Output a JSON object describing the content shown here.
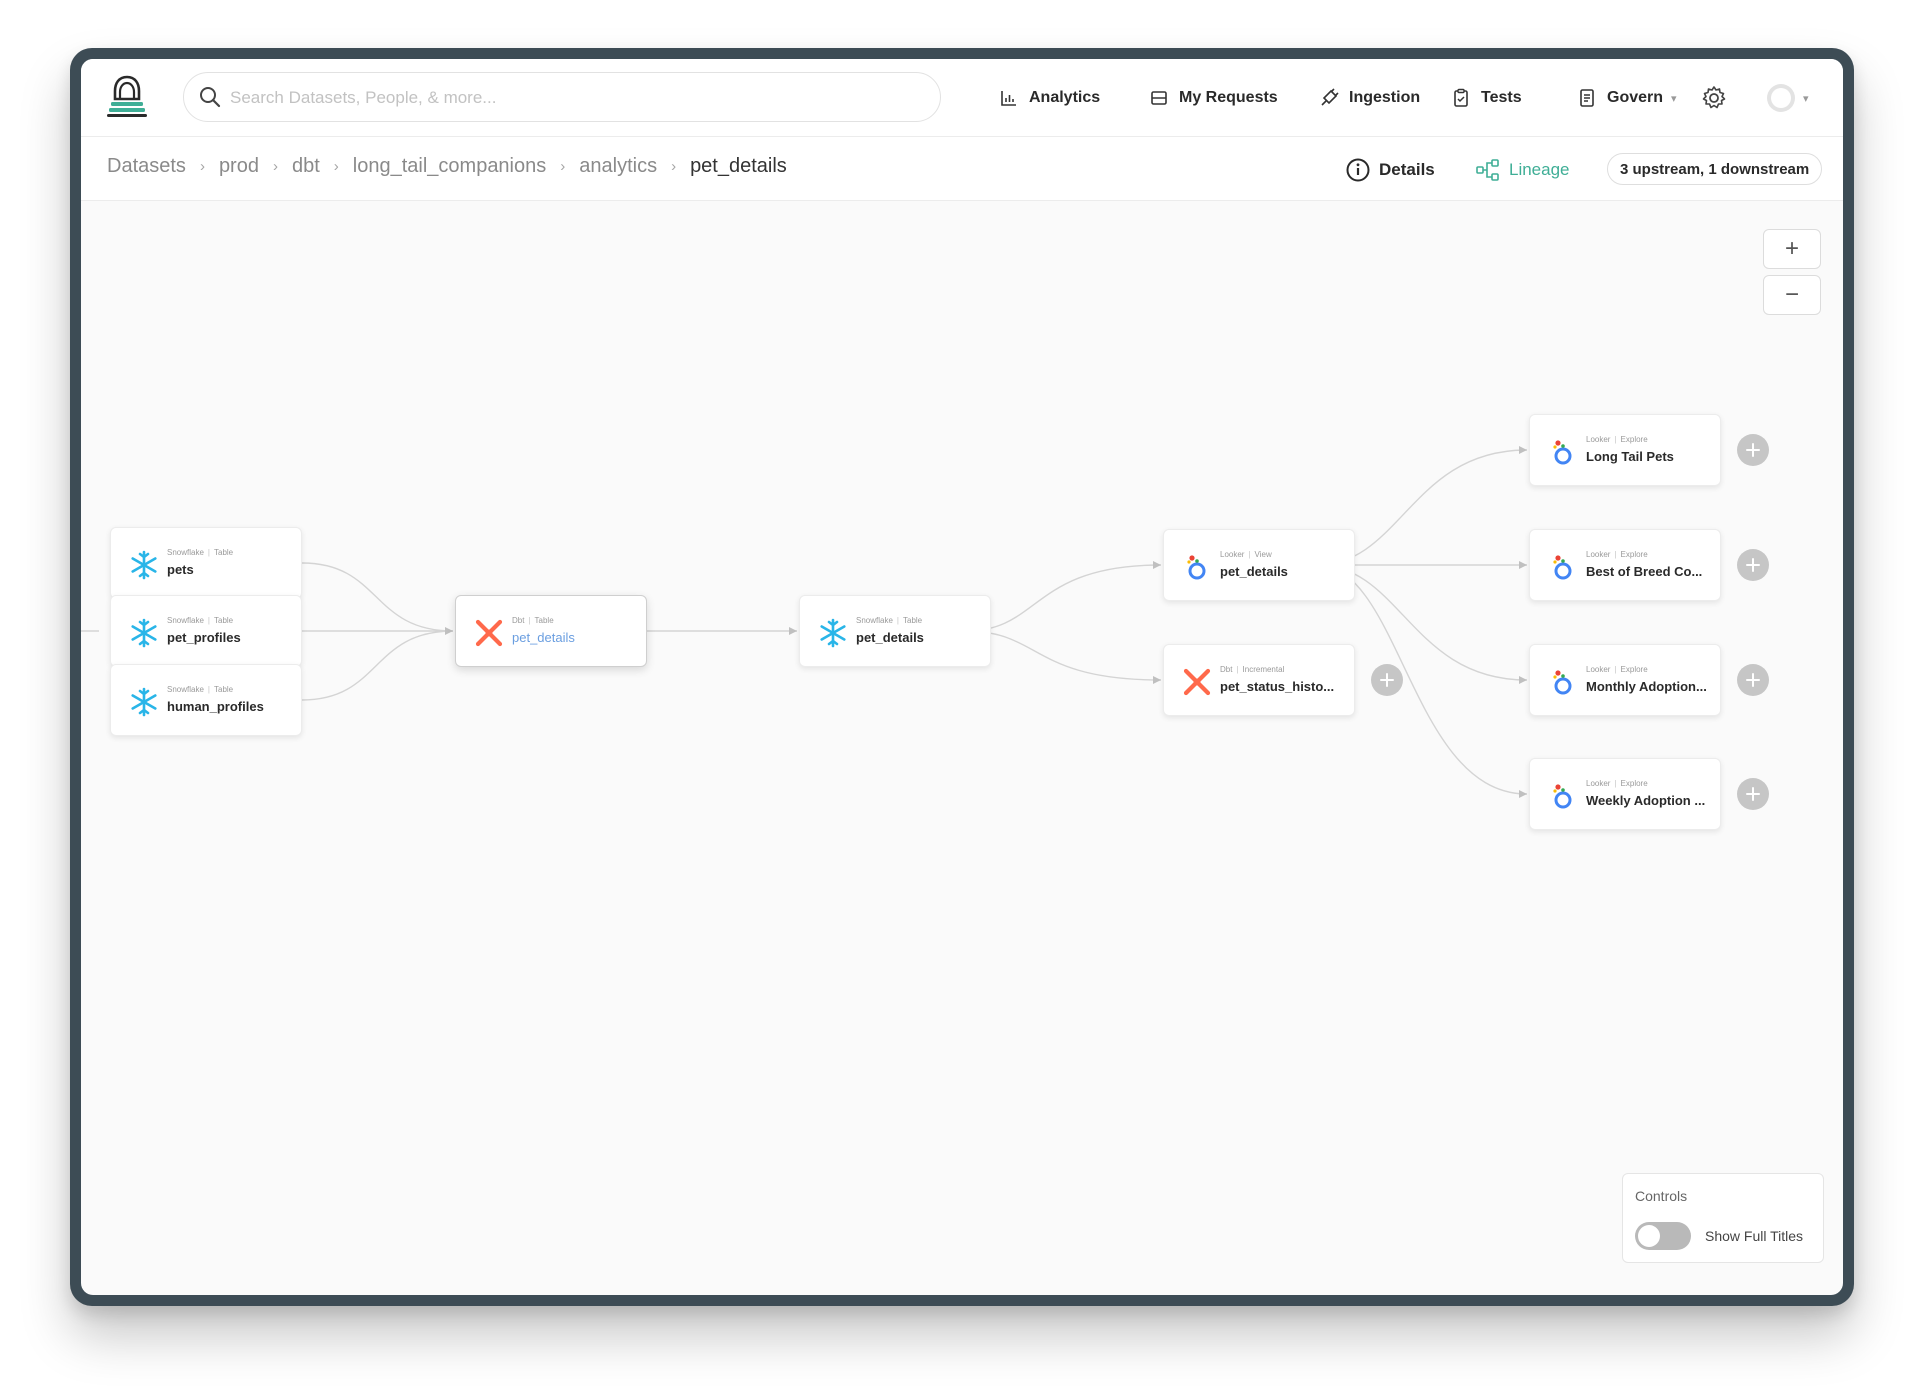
{
  "nav": {
    "search_placeholder": "Search Datasets, People, & more...",
    "items": [
      {
        "label": "Analytics",
        "icon": "bar-chart-icon"
      },
      {
        "label": "My Requests",
        "icon": "inbox-icon"
      },
      {
        "label": "Ingestion",
        "icon": "plug-icon"
      },
      {
        "label": "Tests",
        "icon": "clipboard-icon"
      },
      {
        "label": "Govern",
        "icon": "document-icon"
      }
    ]
  },
  "breadcrumb": [
    "Datasets",
    "prod",
    "dbt",
    "long_tail_companions",
    "analytics",
    "pet_details"
  ],
  "tabs": {
    "details": "Details",
    "lineage": "Lineage"
  },
  "stream_summary": "3 upstream, 1 downstream",
  "zoom": {
    "in": "+",
    "out": "−"
  },
  "nodes": {
    "pets": {
      "platform": "Snowflake",
      "type": "Table",
      "name": "pets"
    },
    "pet_profiles": {
      "platform": "Snowflake",
      "type": "Table",
      "name": "pet_profiles"
    },
    "human_profiles": {
      "platform": "Snowflake",
      "type": "Table",
      "name": "human_profiles"
    },
    "dbt_pet_details": {
      "platform": "Dbt",
      "type": "Table",
      "name": "pet_details"
    },
    "sf_pet_details": {
      "platform": "Snowflake",
      "type": "Table",
      "name": "pet_details"
    },
    "looker_pet_details": {
      "platform": "Looker",
      "type": "View",
      "name": "pet_details"
    },
    "pet_status_history": {
      "platform": "Dbt",
      "type": "Incremental",
      "name": "pet_status_histo..."
    },
    "long_tail_pets": {
      "platform": "Looker",
      "type": "Explore",
      "name": "Long Tail Pets"
    },
    "best_of_breed": {
      "platform": "Looker",
      "type": "Explore",
      "name": "Best of Breed Co..."
    },
    "monthly_adoption": {
      "platform": "Looker",
      "type": "Explore",
      "name": "Monthly Adoption..."
    },
    "weekly_adoption": {
      "platform": "Looker",
      "type": "Explore",
      "name": "Weekly Adoption ..."
    }
  },
  "controls": {
    "title": "Controls",
    "toggle_label": "Show Full Titles",
    "show_full_titles": false
  },
  "colors": {
    "frame": "#3d4c55",
    "accent": "#3fae96",
    "selected_text": "#6a9ee0",
    "snowflake": "#29b5e8",
    "dbt": "#ff694b"
  }
}
